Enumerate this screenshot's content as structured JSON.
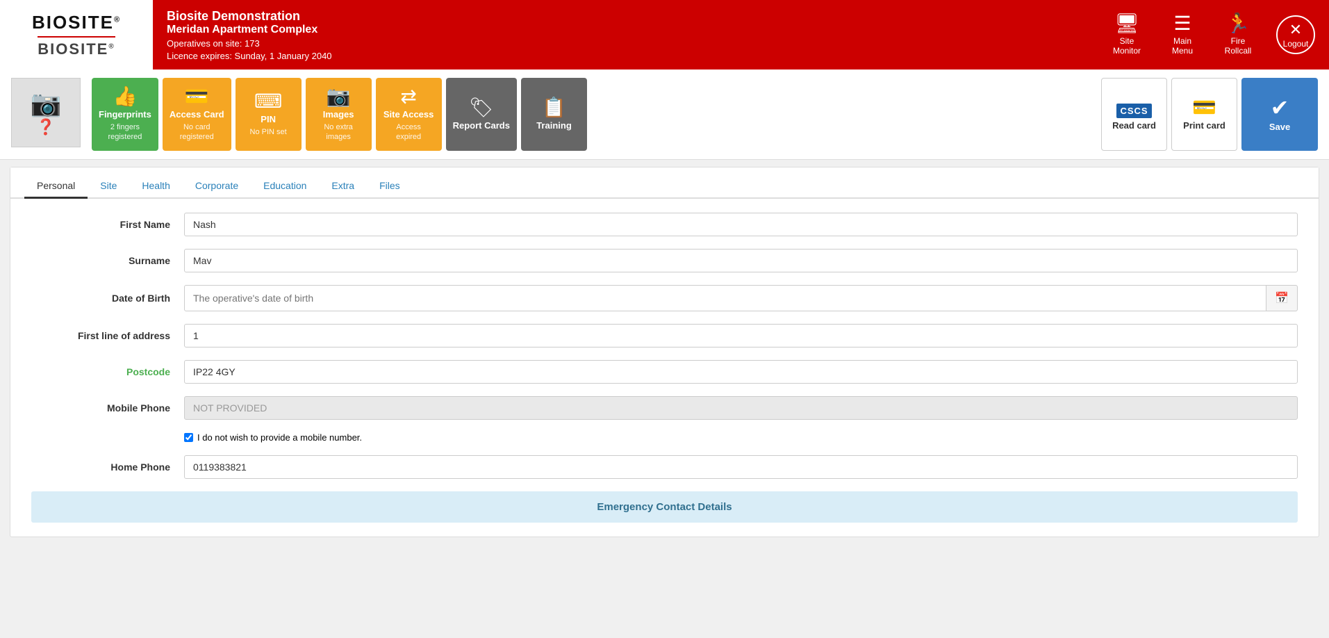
{
  "header": {
    "company": "Biosite Demonstration",
    "site": "Meridan Apartment Complex",
    "operatives": "Operatives on site: 173",
    "licence": "Licence expires: Sunday, 1 January 2040",
    "logo_top": "BIOSITE",
    "logo_bottom": "BIOSITE",
    "nav": {
      "site_monitor": "Site\nMonitor",
      "main_menu": "Main\nMenu",
      "fire_rollcall": "Fire\nRollcall",
      "logout": "Logout"
    }
  },
  "toolbar": {
    "photo_placeholder": "📷",
    "buttons": [
      {
        "id": "fingerprints",
        "label": "Fingerprints",
        "sub": "2 fingers\nregistered",
        "color": "green",
        "icon": "👍"
      },
      {
        "id": "access-card",
        "label": "Access Card",
        "sub": "No card\nregistered",
        "color": "orange",
        "icon": "💳"
      },
      {
        "id": "pin",
        "label": "PIN",
        "sub": "No PIN set",
        "color": "orange",
        "icon": "⌨"
      },
      {
        "id": "images",
        "label": "Images",
        "sub": "No extra\nimages",
        "color": "orange",
        "icon": "📷"
      },
      {
        "id": "site-access",
        "label": "Site Access",
        "sub": "Access\nexpired",
        "color": "orange",
        "icon": "⇄"
      },
      {
        "id": "report-cards",
        "label": "Report Cards",
        "sub": "",
        "color": "dark",
        "icon": "🏷"
      },
      {
        "id": "training",
        "label": "Training",
        "sub": "",
        "color": "dark",
        "icon": "📋"
      },
      {
        "id": "read-card",
        "label": "Read card",
        "sub": "",
        "color": "white",
        "icon": "CSCS"
      },
      {
        "id": "print-card",
        "label": "Print card",
        "sub": "",
        "color": "white",
        "icon": "💳"
      },
      {
        "id": "save",
        "label": "Save",
        "sub": "",
        "color": "blue",
        "icon": "✔"
      }
    ]
  },
  "tabs": {
    "items": [
      {
        "id": "personal",
        "label": "Personal",
        "active": true,
        "color": "dark"
      },
      {
        "id": "site",
        "label": "Site",
        "active": false,
        "color": "blue"
      },
      {
        "id": "health",
        "label": "Health",
        "active": false,
        "color": "blue"
      },
      {
        "id": "corporate",
        "label": "Corporate",
        "active": false,
        "color": "blue"
      },
      {
        "id": "education",
        "label": "Education",
        "active": false,
        "color": "blue"
      },
      {
        "id": "extra",
        "label": "Extra",
        "active": false,
        "color": "blue"
      },
      {
        "id": "files",
        "label": "Files",
        "active": false,
        "color": "blue"
      }
    ]
  },
  "form": {
    "fields": [
      {
        "id": "first-name",
        "label": "First Name",
        "value": "Nash",
        "placeholder": "",
        "type": "text",
        "disabled": false,
        "label_color": "dark"
      },
      {
        "id": "surname",
        "label": "Surname",
        "value": "Mav",
        "placeholder": "",
        "type": "text",
        "disabled": false,
        "label_color": "dark"
      },
      {
        "id": "dob",
        "label": "Date of Birth",
        "value": "",
        "placeholder": "The operative's date of birth",
        "type": "text",
        "disabled": false,
        "has_btn": true,
        "label_color": "dark"
      },
      {
        "id": "address",
        "label": "First line of address",
        "value": "1",
        "placeholder": "",
        "type": "text",
        "disabled": false,
        "label_color": "dark"
      },
      {
        "id": "postcode",
        "label": "Postcode",
        "value": "IP22 4GY",
        "placeholder": "",
        "type": "text",
        "disabled": false,
        "label_color": "green"
      },
      {
        "id": "mobile-phone",
        "label": "Mobile Phone",
        "value": "NOT PROVIDED",
        "placeholder": "",
        "type": "text",
        "disabled": true,
        "label_color": "dark"
      },
      {
        "id": "home-phone",
        "label": "Home Phone",
        "value": "0119383821",
        "placeholder": "",
        "type": "text",
        "disabled": false,
        "label_color": "dark"
      }
    ],
    "checkbox_label": "I do not wish to provide a mobile number.",
    "checkbox_checked": true,
    "emergency_title": "Emergency Contact Details"
  }
}
